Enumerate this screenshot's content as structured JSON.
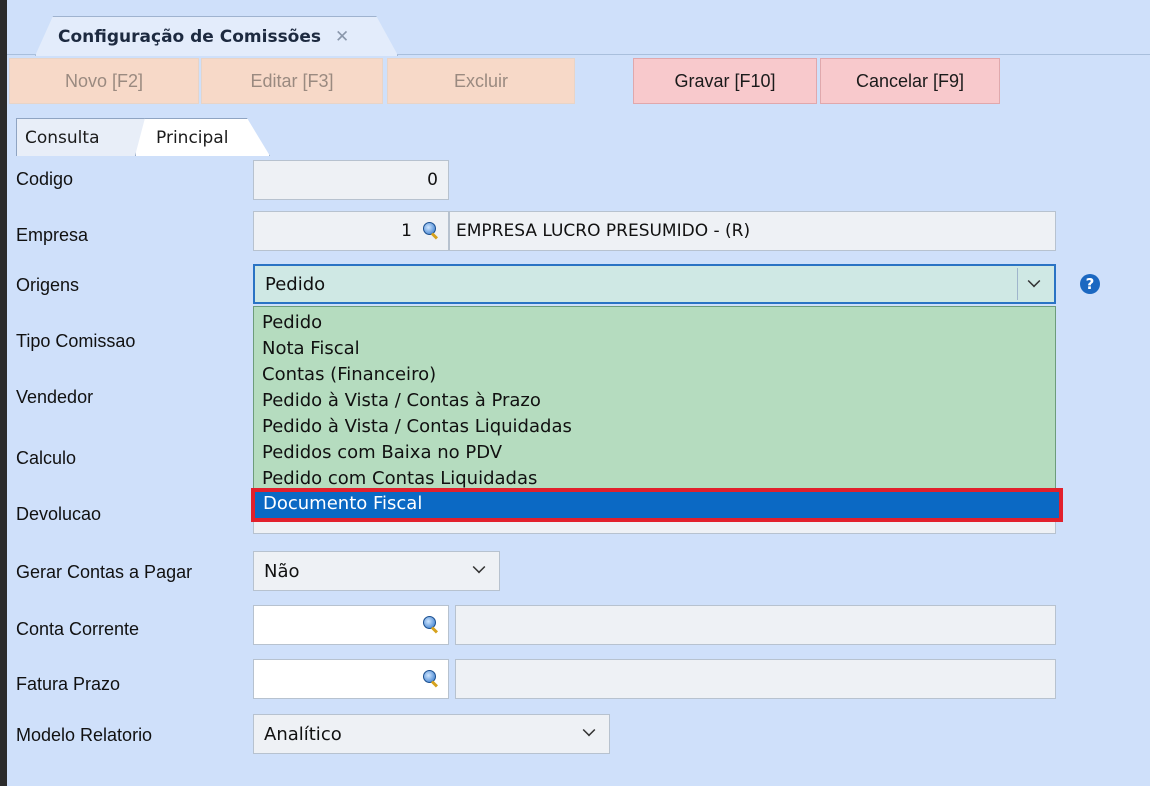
{
  "window": {
    "tab_title": "Configuração de Comissões",
    "tab_close": "✕"
  },
  "toolbar": {
    "novo": "Novo [F2]",
    "editar": "Editar [F3]",
    "excluir": "Excluir",
    "gravar": "Gravar [F10]",
    "cancelar": "Cancelar [F9]"
  },
  "tabs": {
    "consulta": "Consulta",
    "principal": "Principal"
  },
  "form": {
    "codigo": {
      "label": "Codigo",
      "value": "0"
    },
    "empresa": {
      "label": "Empresa",
      "code": "1",
      "name": "EMPRESA LUCRO PRESUMIDO - (R)"
    },
    "origens": {
      "label": "Origens",
      "value": "Pedido"
    },
    "tipo_comissao": {
      "label": "Tipo Comissao"
    },
    "vendedor": {
      "label": "Vendedor"
    },
    "calculo": {
      "label": "Calculo"
    },
    "devolucao": {
      "label": "Devolucao"
    },
    "gerar_contas": {
      "label": "Gerar Contas a Pagar",
      "value": "Não"
    },
    "conta_corrente": {
      "label": "Conta Corrente"
    },
    "fatura_prazo": {
      "label": "Fatura Prazo"
    },
    "modelo_relatorio": {
      "label": "Modelo Relatorio",
      "value": "Analítico"
    }
  },
  "dropdown": {
    "items": [
      "Pedido",
      "Nota Fiscal",
      "Contas (Financeiro)",
      "Pedido à Vista / Contas à Prazo",
      "Pedido à Vista / Contas Liquidadas",
      "Pedidos com Baixa no PDV",
      "Pedido com Contas Liquidadas"
    ],
    "selected": "Documento Fiscal"
  },
  "icons": {
    "lookup": "search-icon",
    "help": "help-icon",
    "chevron": "chevron-down-icon"
  },
  "help_glyph": "?"
}
